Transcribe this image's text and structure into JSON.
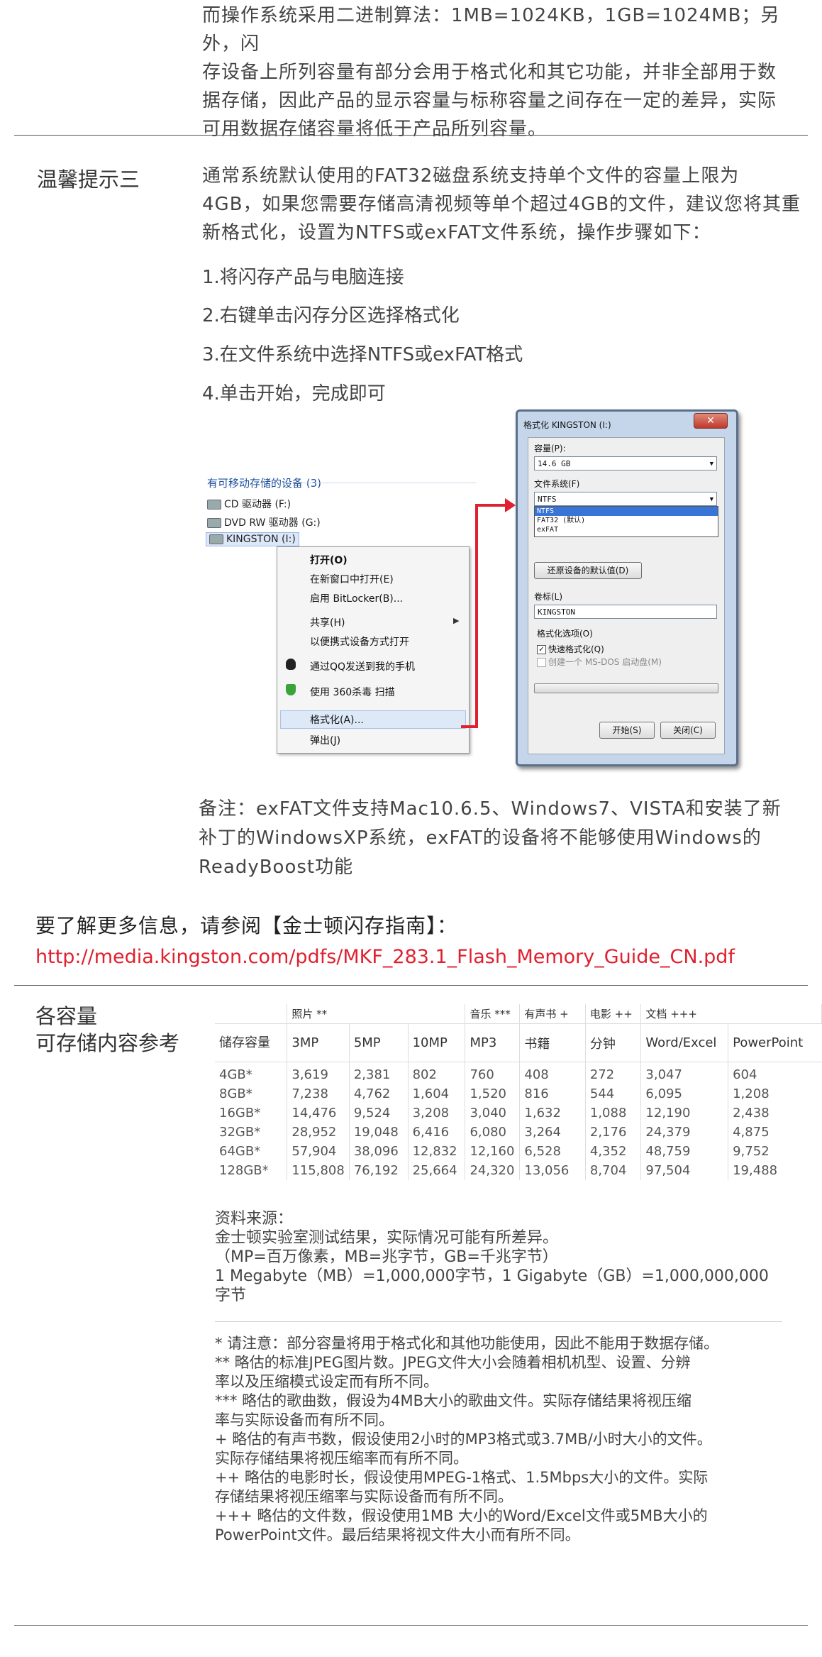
{
  "intro_paragraph": [
    "而操作系统采用二进制算法：1MB=1024KB，1GB=1024MB；另外，闪",
    "存设备上所列容量有部分会用于格式化和其它功能，并非全部用于数",
    "据存储，因此产品的显示容量与标称容量之间存在一定的差异，实际",
    "可用数据存储容量将低于产品所列容量。"
  ],
  "tip3": {
    "heading": "温馨提示三",
    "body": [
      "通常系统默认使用的FAT32磁盘系统支持单个文件的容量上限为",
      "4GB，如果您需要存储高清视频等单个超过4GB的文件，建议您将其重",
      "新格式化，设置为NTFS或exFAT文件系统，操作步骤如下："
    ],
    "steps": [
      "1.将闪存产品与电脑连接",
      "2.右键单击闪存分区选择格式化",
      "3.在文件系统中选择NTFS或exFAT格式",
      "4.单击开始，完成即可"
    ]
  },
  "explorer": {
    "group_title": "有可移动存储的设备 (3)",
    "drives": [
      "CD 驱动器 (F:)",
      "DVD RW 驱动器 (G:)",
      "KINGSTON (I:)"
    ]
  },
  "context_menu": [
    "打开(O)",
    "在新窗口中打开(E)",
    "启用 BitLocker(B)...",
    "共享(H)",
    "以便携式设备方式打开",
    "通过QQ发送到我的手机",
    "使用 360杀毒 扫描",
    "格式化(A)...",
    "弹出(J)"
  ],
  "format_dialog": {
    "title": "格式化 KINGSTON (I:)",
    "capacity_label": "容量(P):",
    "capacity_value": "14.6 GB",
    "fs_label": "文件系统(F)",
    "fs_selected": "NTFS",
    "fs_options": [
      "NTFS",
      "FAT32 (默认)",
      "exFAT"
    ],
    "restore_button": "还原设备的默认值(D)",
    "volume_label": "卷标(L)",
    "volume_value": "KINGSTON",
    "format_options_label": "格式化选项(O)",
    "quick_format": "快速格式化(Q)",
    "msdos_disk": "创建一个 MS-DOS 启动盘(M)",
    "start_button": "开始(S)",
    "close_button": "关闭(C)"
  },
  "remark": [
    "备注：exFAT文件支持Mac10.6.5、Windows7、VISTA和安装了新",
    "补丁的WindowsXP系统，exFAT的设备将不能够使用Windows的",
    "ReadyBoost功能"
  ],
  "more_info": {
    "text": "要了解更多信息，请参阅【金士顿闪存指南】：",
    "url": "http://media.kingston.com/pdfs/MKF_283.1_Flash_Memory_Guide_CN.pdf"
  },
  "capacity_section": {
    "title_lines": [
      "各容量",
      "可存储内容参考"
    ],
    "group_headers": [
      "照片 **",
      "音乐 ***",
      "有声书 +",
      "电影 ++",
      "文档 +++"
    ],
    "column_headers": [
      "储存容量",
      "3MP",
      "5MP",
      "10MP",
      "MP3",
      "书籍",
      "分钟",
      "Word/Excel",
      "PowerPoint"
    ],
    "rows": [
      [
        "4GB*",
        "3,619",
        "2,381",
        "802",
        "760",
        "408",
        "272",
        "3,047",
        "604"
      ],
      [
        "8GB*",
        "7,238",
        "4,762",
        "1,604",
        "1,520",
        "816",
        "544",
        "6,095",
        "1,208"
      ],
      [
        "16GB*",
        "14,476",
        "9,524",
        "3,208",
        "3,040",
        "1,632",
        "1,088",
        "12,190",
        "2,438"
      ],
      [
        "32GB*",
        "28,952",
        "19,048",
        "6,416",
        "6,080",
        "3,264",
        "2,176",
        "24,379",
        "4,875"
      ],
      [
        "64GB*",
        "57,904",
        "38,096",
        "12,832",
        "12,160",
        "6,528",
        "4,352",
        "48,759",
        "9,752"
      ],
      [
        "128GB*",
        "115,808",
        "76,192",
        "25,664",
        "24,320",
        "13,056",
        "8,704",
        "97,504",
        "19,488"
      ]
    ],
    "source": [
      "资料来源：",
      "金士顿实验室测试结果，实际情况可能有所差异。",
      "（MP=百万像素，MB=兆字节，GB=千兆字节）",
      "1 Megabyte（MB）=1,000,000字节，1 Gigabyte（GB）=1,000,000,000",
      "字节"
    ],
    "footnotes": [
      "* 请注意：部分容量将用于格式化和其他功能使用，因此不能用于数据存储。",
      "** 略估的标准JPEG图片数。JPEG文件大小会随着相机机型、设置、分辨",
      "率以及压缩模式设定而有所不同。",
      "*** 略估的歌曲数，假设为4MB大小的歌曲文件。实际存储结果将视压缩",
      "率与实际设备而有所不同。",
      "+ 略估的有声书数，假设使用2小时的MP3格式或3.7MB/小时大小的文件。",
      "实际存储结果将视压缩率而有所不同。",
      "++ 略估的电影时长，假设使用MPEG-1格式、1.5Mbps大小的文件。实际",
      "存储结果将视压缩率与实际设备而有所不同。",
      "+++ 略估的文件数，假设使用1MB 大小的Word/Excel文件或5MB大小的",
      "PowerPoint文件。最后结果将视文件大小而有所不同。"
    ]
  },
  "colors": {
    "link": "#e0202e",
    "arrow": "#e0202e",
    "rule": "#555555"
  }
}
